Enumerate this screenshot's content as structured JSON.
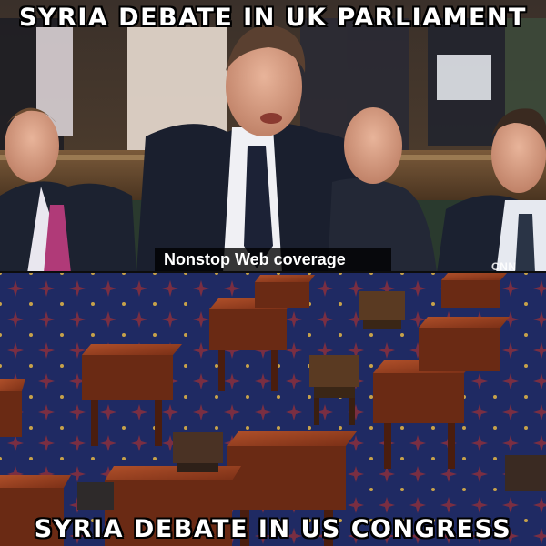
{
  "captions": {
    "top": "SYRIA DEBATE IN UK PARLIAMENT",
    "bottom": "SYRIA DEBATE IN US CONGRESS"
  },
  "broadcast": {
    "lower_third": "Nonstop Web coverage",
    "network_logo": "CNN"
  },
  "colors": {
    "caption_text": "#ffffff",
    "caption_outline": "#000000",
    "carpet": "#1f2a63",
    "desk_wood": "#8a3a1c",
    "bench_green": "#2f5a3a"
  }
}
